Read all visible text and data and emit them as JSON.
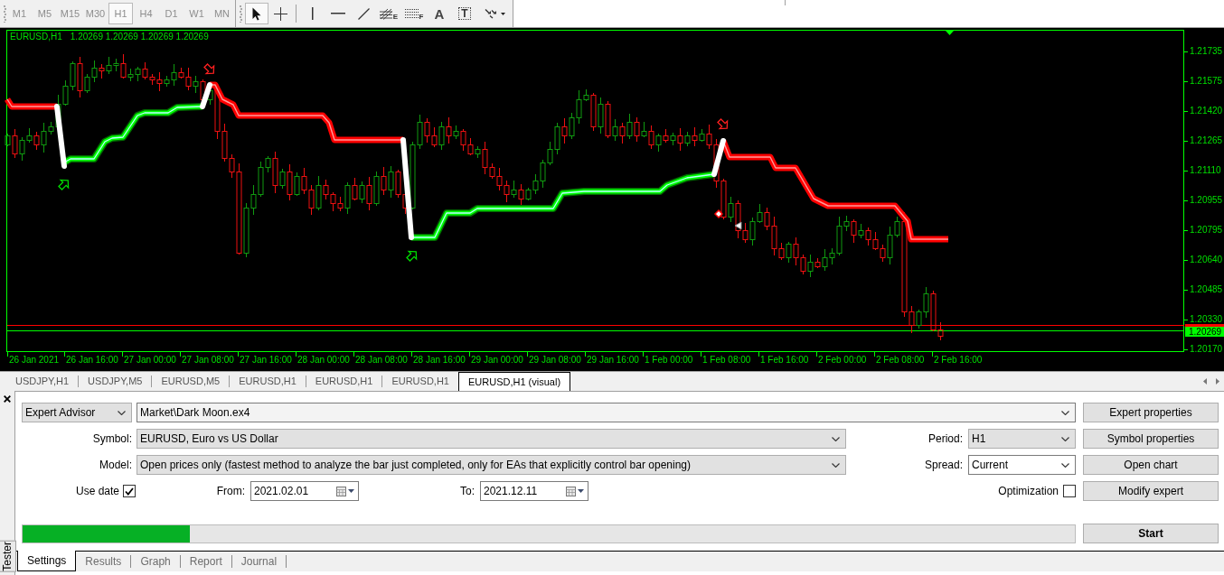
{
  "toolbar": {
    "timeframes": [
      {
        "label": "M1",
        "selected": false,
        "disabled": true
      },
      {
        "label": "M5",
        "selected": false,
        "disabled": true
      },
      {
        "label": "M15",
        "selected": false,
        "disabled": true
      },
      {
        "label": "M30",
        "selected": false,
        "disabled": true
      },
      {
        "label": "H1",
        "selected": true,
        "disabled": true
      },
      {
        "label": "H4",
        "selected": false,
        "disabled": true
      },
      {
        "label": "D1",
        "selected": false,
        "disabled": true
      },
      {
        "label": "W1",
        "selected": false,
        "disabled": true
      },
      {
        "label": "MN",
        "selected": false,
        "disabled": true
      }
    ],
    "tool_groups": [
      [
        {
          "kind": "cursor",
          "selected": true
        },
        {
          "kind": "crosshair",
          "selected": false
        }
      ],
      [
        {
          "kind": "vertical-line",
          "selected": false
        },
        {
          "kind": "horizontal-line",
          "selected": false
        },
        {
          "kind": "trend-line",
          "selected": false
        },
        {
          "kind": "fibo-fan",
          "label": "E",
          "selected": false
        },
        {
          "kind": "fibo-levels",
          "label": "F",
          "selected": false
        },
        {
          "kind": "text",
          "label": "A",
          "selected": false
        },
        {
          "kind": "text-label",
          "label": "T",
          "selected": false
        },
        {
          "kind": "arrows",
          "selected": false
        }
      ]
    ]
  },
  "chart": {
    "symbol": "EURUSD,H1",
    "ohlc": "1.20269 1.20269 1.20269 1.20269",
    "price_ticks": [
      "1.21735",
      "1.21575",
      "1.21420",
      "1.21265",
      "1.21110",
      "1.20955",
      "1.20795",
      "1.20640",
      "1.20485",
      "1.20330",
      "1.20170"
    ],
    "bid_tag": "1.20269",
    "time_labels": [
      "26 Jan 2021",
      "26 Jan 16:00",
      "27 Jan 00:00",
      "27 Jan 08:00",
      "27 Jan 16:00",
      "28 Jan 00:00",
      "28 Jan 08:00",
      "28 Jan 16:00",
      "29 Jan 00:00",
      "29 Jan 08:00",
      "29 Jan 16:00",
      "1 Feb 00:00",
      "1 Feb 08:00",
      "1 Feb 16:00",
      "2 Feb 00:00",
      "2 Feb 08:00",
      "2 Feb 16:00"
    ]
  },
  "chart_tabs": [
    {
      "label": "USDJPY,H1",
      "selected": false
    },
    {
      "label": "USDJPY,M5",
      "selected": false
    },
    {
      "label": "EURUSD,M5",
      "selected": false
    },
    {
      "label": "EURUSD,H1",
      "selected": false
    },
    {
      "label": "EURUSD,H1",
      "selected": false
    },
    {
      "label": "EURUSD,H1",
      "selected": false
    },
    {
      "label": "EURUSD,H1 (visual)",
      "selected": true
    }
  ],
  "tester": {
    "side_label": "Tester",
    "expert_type": "Expert Advisor",
    "expert": "Market\\Dark Moon.ex4",
    "symbol": {
      "label": "Symbol:",
      "value": "EURUSD, Euro vs US Dollar"
    },
    "period": {
      "label": "Period:",
      "value": "H1"
    },
    "model": {
      "label": "Model:",
      "value": "Open prices only (fastest method to analyze the bar just completed, only for EAs that explicitly control bar opening)"
    },
    "spread": {
      "label": "Spread:",
      "value": "Current"
    },
    "use_date": {
      "label": "Use date",
      "checked": true
    },
    "from": {
      "label": "From:",
      "value": "2021.02.01"
    },
    "to": {
      "label": "To:",
      "value": "2021.12.11"
    },
    "optimization": {
      "label": "Optimization",
      "checked": false
    },
    "buttons": [
      {
        "label": "Expert properties"
      },
      {
        "label": "Symbol properties"
      },
      {
        "label": "Open chart"
      },
      {
        "label": "Modify expert"
      }
    ],
    "start": {
      "label": "Start"
    },
    "progress": {
      "level": 0.159
    },
    "tabs": [
      {
        "label": "Settings",
        "selected": true
      },
      {
        "label": "Results",
        "selected": false
      },
      {
        "label": "Graph",
        "selected": false
      },
      {
        "label": "Report",
        "selected": false
      },
      {
        "label": "Journal",
        "selected": false
      }
    ]
  }
}
